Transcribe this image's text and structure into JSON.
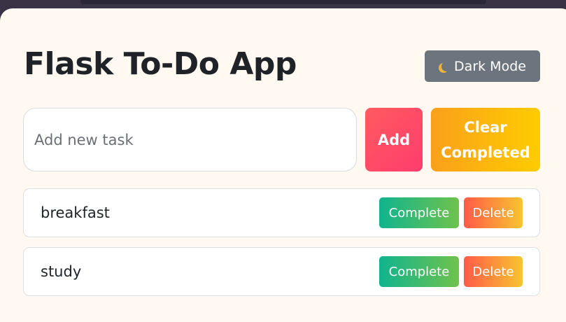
{
  "app": {
    "title": "Flask To-Do App",
    "dark_mode_label": "Dark Mode"
  },
  "new_task": {
    "placeholder": "Add new task",
    "value": ""
  },
  "actions": {
    "add_label": "Add",
    "clear_completed_label": "Clear Completed"
  },
  "tasks": [
    {
      "text": "breakfast",
      "complete_label": "Complete",
      "delete_label": "Delete"
    },
    {
      "text": "study",
      "complete_label": "Complete",
      "delete_label": "Delete"
    }
  ],
  "colors": {
    "page_background": "#3a3346",
    "card_background": "#fff9f1",
    "dark_mode_button": "#6c757d",
    "add_button": "#ff4b63",
    "clear_button": "#fbb812",
    "complete_button": "#3bbb6e",
    "delete_button": "#fb8a3d",
    "moon": "#f2b33d"
  },
  "icons": {
    "dark_mode": "crescent-moon-icon"
  }
}
